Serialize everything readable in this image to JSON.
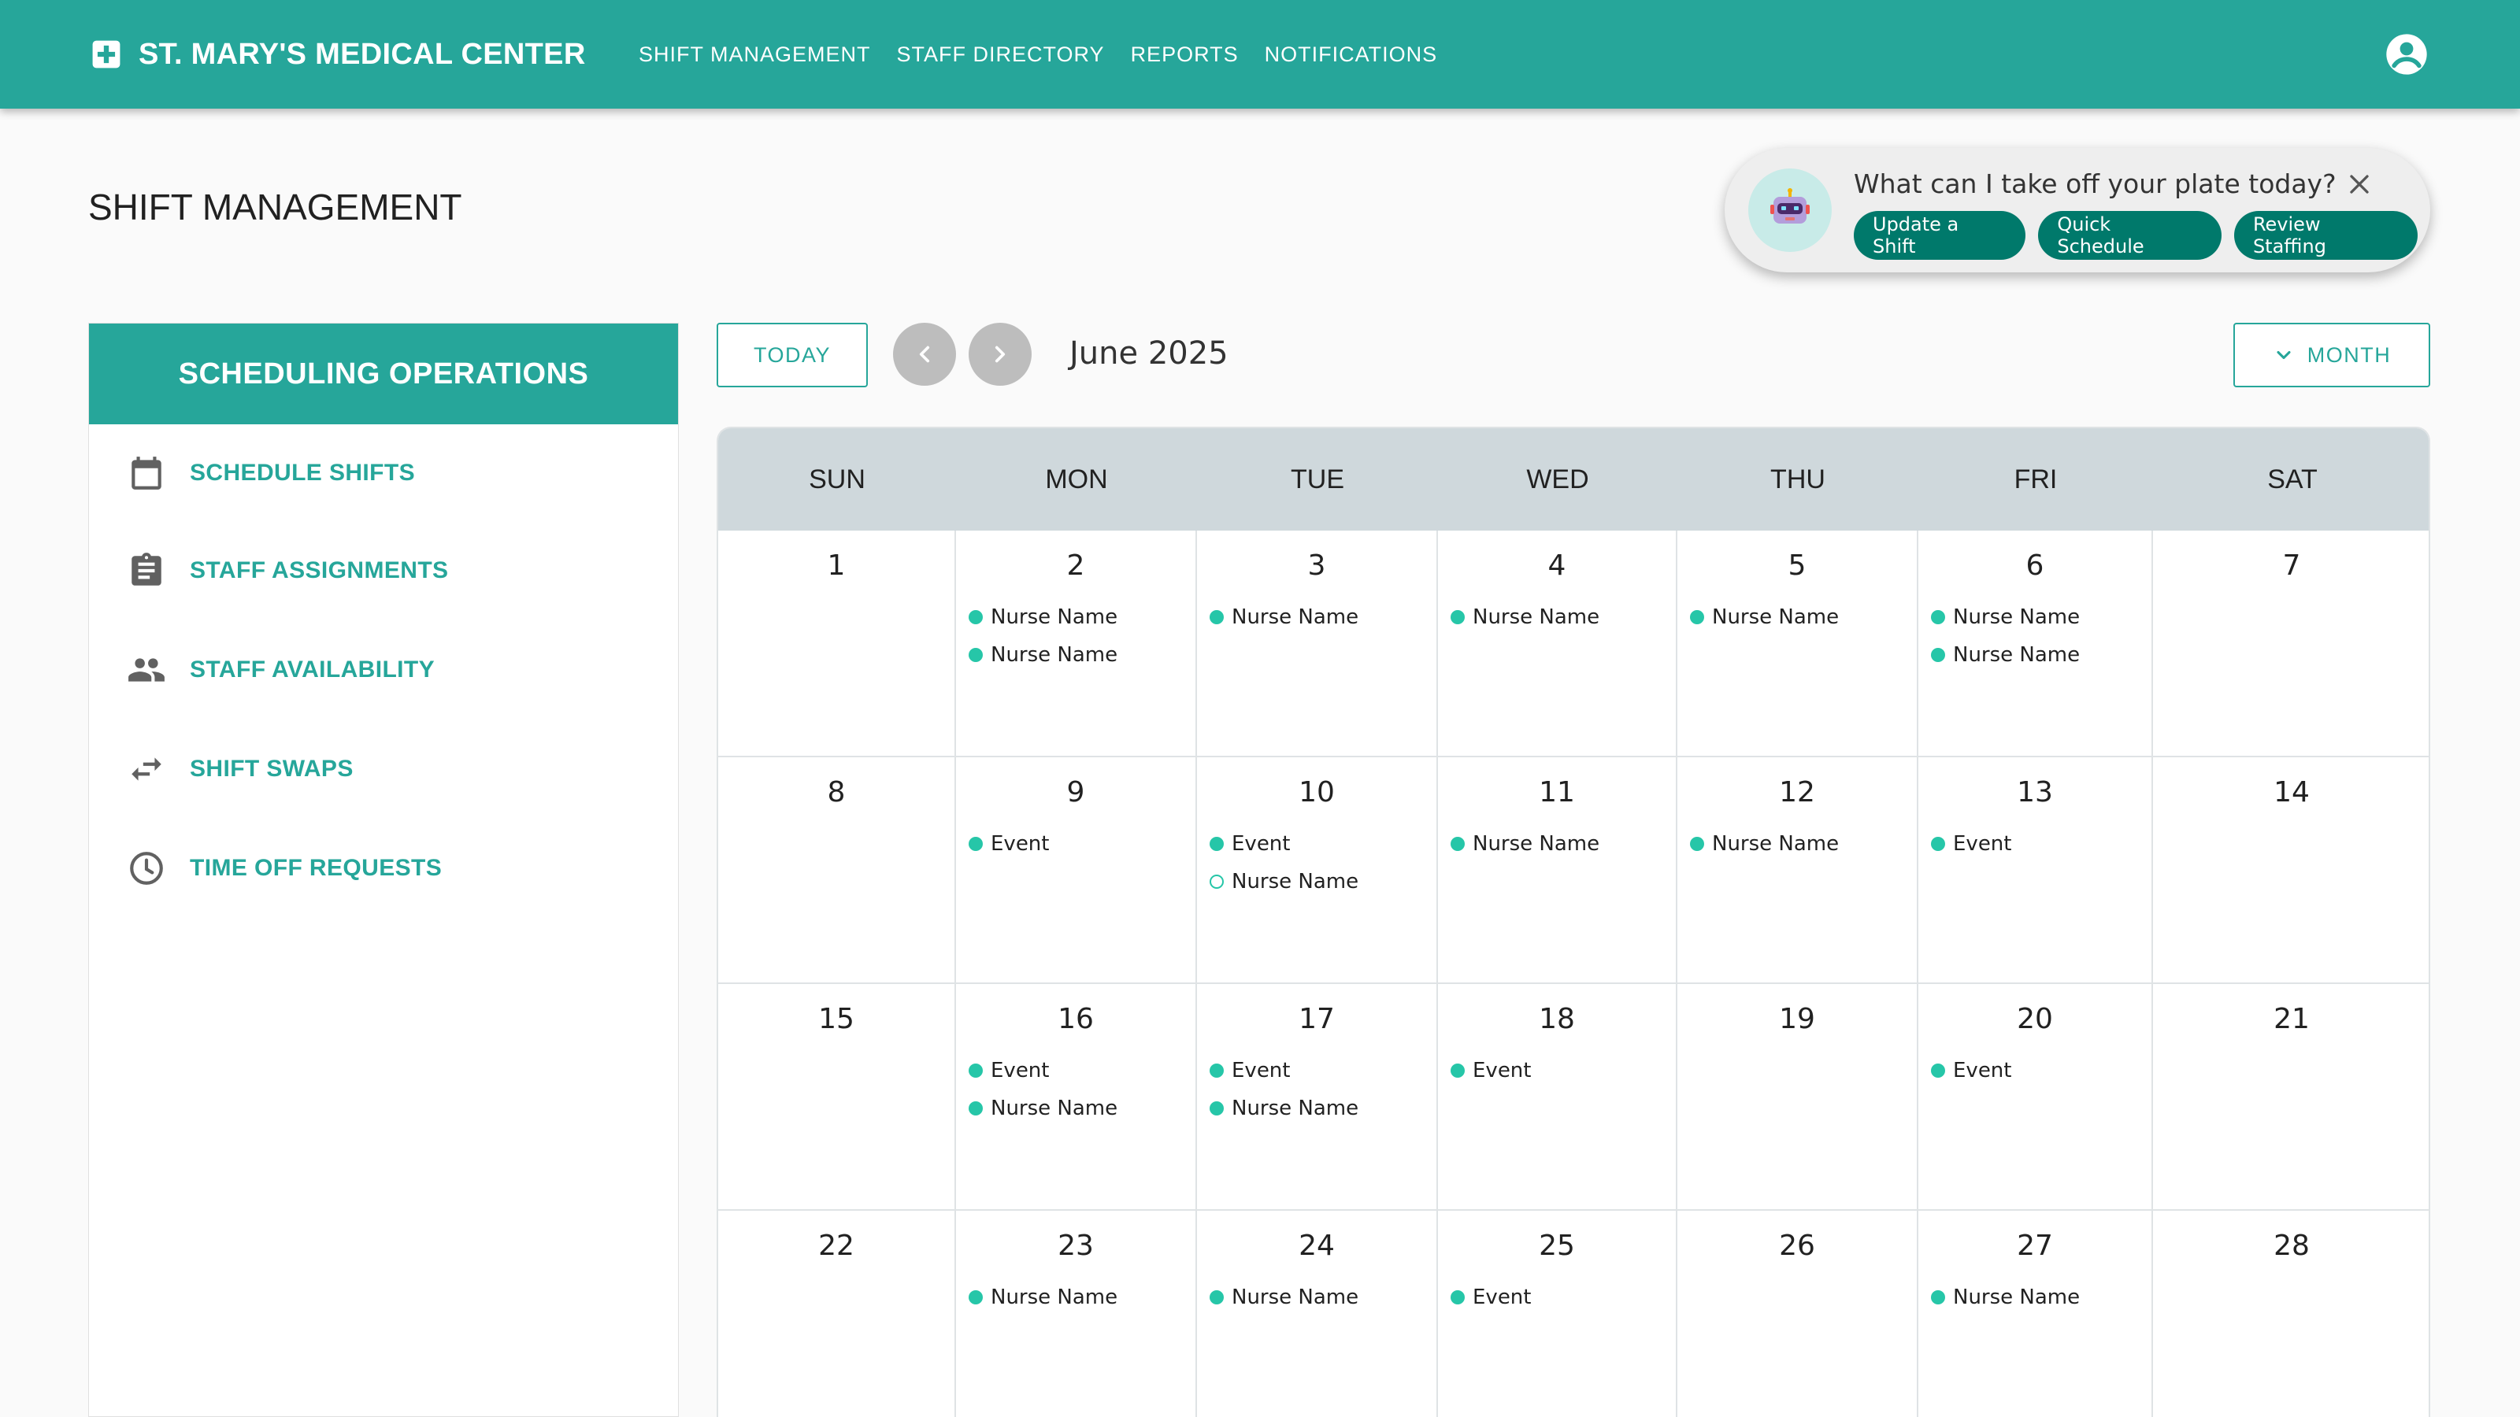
{
  "app": {
    "title": "ST. MARY'S MEDICAL CENTER",
    "nav": [
      "SHIFT MANAGEMENT",
      "STAFF DIRECTORY",
      "REPORTS",
      "NOTIFICATIONS"
    ]
  },
  "page": {
    "title": "SHIFT MANAGEMENT"
  },
  "assistant": {
    "question": "What can I take off your plate today?",
    "actions": [
      "Update a Shift",
      "Quick Schedule",
      "Review Staffing"
    ]
  },
  "sidebar": {
    "title": "SCHEDULING OPERATIONS",
    "items": [
      {
        "label": "SCHEDULE SHIFTS",
        "icon": "calendar-icon"
      },
      {
        "label": "STAFF ASSIGNMENTS",
        "icon": "clipboard-icon"
      },
      {
        "label": "STAFF AVAILABILITY",
        "icon": "people-icon"
      },
      {
        "label": "SHIFT SWAPS",
        "icon": "swap-icon"
      },
      {
        "label": "TIME OFF REQUESTS",
        "icon": "clock-icon"
      }
    ]
  },
  "toolbar": {
    "today_label": "TODAY",
    "month_label": "June 2025",
    "view_label": "MONTH"
  },
  "calendar": {
    "weekdays": [
      "SUN",
      "MON",
      "TUE",
      "WED",
      "THU",
      "FRI",
      "SAT"
    ],
    "weeks": [
      [
        {
          "day": "1",
          "events": []
        },
        {
          "day": "2",
          "events": [
            {
              "label": "Nurse Name"
            },
            {
              "label": "Nurse Name"
            }
          ]
        },
        {
          "day": "3",
          "events": [
            {
              "label": "Nurse Name"
            }
          ]
        },
        {
          "day": "4",
          "events": [
            {
              "label": "Nurse Name"
            }
          ]
        },
        {
          "day": "5",
          "events": [
            {
              "label": "Nurse Name"
            }
          ]
        },
        {
          "day": "6",
          "events": [
            {
              "label": "Nurse Name"
            },
            {
              "label": "Nurse Name"
            }
          ]
        },
        {
          "day": "7",
          "events": []
        }
      ],
      [
        {
          "day": "8",
          "events": []
        },
        {
          "day": "9",
          "events": [
            {
              "label": "Event"
            }
          ]
        },
        {
          "day": "10",
          "events": [
            {
              "label": "Event"
            },
            {
              "label": "Nurse Name",
              "hollow": true
            }
          ]
        },
        {
          "day": "11",
          "events": [
            {
              "label": "Nurse Name"
            }
          ]
        },
        {
          "day": "12",
          "events": [
            {
              "label": "Nurse Name"
            }
          ]
        },
        {
          "day": "13",
          "events": [
            {
              "label": "Event"
            }
          ]
        },
        {
          "day": "14",
          "events": []
        }
      ],
      [
        {
          "day": "15",
          "events": []
        },
        {
          "day": "16",
          "events": [
            {
              "label": "Event"
            },
            {
              "label": "Nurse Name"
            }
          ]
        },
        {
          "day": "17",
          "events": [
            {
              "label": "Event"
            },
            {
              "label": "Nurse Name"
            }
          ]
        },
        {
          "day": "18",
          "events": [
            {
              "label": "Event"
            }
          ]
        },
        {
          "day": "19",
          "events": []
        },
        {
          "day": "20",
          "events": [
            {
              "label": "Event"
            }
          ]
        },
        {
          "day": "21",
          "events": []
        }
      ],
      [
        {
          "day": "22",
          "events": []
        },
        {
          "day": "23",
          "events": [
            {
              "label": "Nurse Name"
            }
          ]
        },
        {
          "day": "24",
          "events": [
            {
              "label": "Nurse Name"
            }
          ]
        },
        {
          "day": "25",
          "events": [
            {
              "label": "Event"
            }
          ]
        },
        {
          "day": "26",
          "events": []
        },
        {
          "day": "27",
          "events": [
            {
              "label": "Nurse Name"
            }
          ]
        },
        {
          "day": "28",
          "events": []
        }
      ]
    ]
  },
  "colors": {
    "primary": "#26a69a",
    "chip": "#00796b",
    "event_dot": "#26c6a8",
    "calendar_header": "#cfd8dc"
  }
}
